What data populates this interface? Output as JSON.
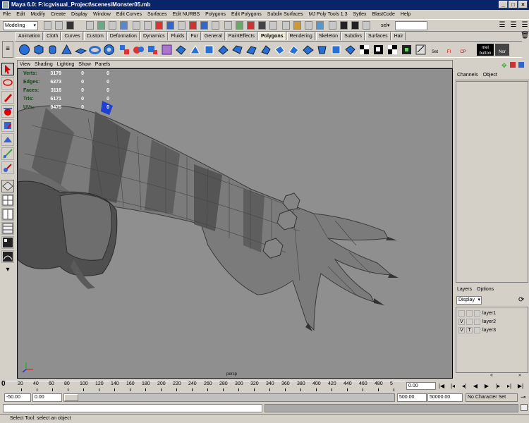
{
  "window": {
    "title": "Maya 6.0: F:\\cgvisual_Project\\scenes\\Monster05.mb"
  },
  "menu": [
    "File",
    "Edit",
    "Modify",
    "Create",
    "Display",
    "Window",
    "Edit Curves",
    "Surfaces",
    "Edit NURBS",
    "Polygons",
    "Edit Polygons",
    "Subdiv Surfaces",
    "MJ Poly Tools 1.3",
    "Sytlex",
    "BlastCode",
    "Help"
  ],
  "status_line": {
    "mode": "Modeling",
    "sel_label": "sel▾"
  },
  "shelf_tabs": [
    "Animation",
    "Cloth",
    "Curves",
    "Custom",
    "Deformation",
    "Dynamics",
    "Fluids",
    "Fur",
    "General",
    "PaintEffects",
    "Polygons",
    "Rendering",
    "Skeleton",
    "Subdivs",
    "Surfaces",
    "Hair"
  ],
  "shelf_active": "Polygons",
  "shelf_labels": [
    "Set",
    "FI",
    "CP",
    "mel button",
    "Nor"
  ],
  "panel_menu": [
    "View",
    "Shading",
    "Lighting",
    "Show",
    "Panels"
  ],
  "hud": [
    {
      "label": "Verts:",
      "a": "3179",
      "b": "0",
      "c": "0"
    },
    {
      "label": "Edges:",
      "a": "6273",
      "b": "0",
      "c": "0"
    },
    {
      "label": "Faces:",
      "a": "3116",
      "b": "0",
      "c": "0"
    },
    {
      "label": "Tris:",
      "a": "6171",
      "b": "0",
      "c": "0"
    },
    {
      "label": "UVs:",
      "a": "9475",
      "b": "0",
      "c": "0"
    }
  ],
  "camera": "persp",
  "channel_box": {
    "menu": [
      "Channels",
      "Object"
    ]
  },
  "layer_editor": {
    "menu": [
      "Layers",
      "Options"
    ],
    "display": "Display",
    "layers": [
      {
        "name": "layer1",
        "v": "",
        "t": ""
      },
      {
        "name": "layer2",
        "v": "V",
        "t": ""
      },
      {
        "name": "layer3",
        "v": "V",
        "t": "T"
      }
    ]
  },
  "timeline": {
    "ticks": [
      "20",
      "40",
      "60",
      "80",
      "100",
      "120",
      "140",
      "160",
      "180",
      "200",
      "220",
      "240",
      "260",
      "280",
      "300",
      "320",
      "340",
      "360",
      "380",
      "400",
      "420",
      "440",
      "460",
      "480",
      "5"
    ],
    "start_tick": "0",
    "current_frame": "0.00"
  },
  "range": {
    "start": "-50.00",
    "playback_start": "0.00",
    "playback_end": "500.00",
    "end": "50000.00",
    "character": "No Character Set"
  },
  "help_line": "Select Tool: select an object",
  "colors": {
    "viewport": "#8f8f8f",
    "title_bar": "#0a246a",
    "ui": "#d4d0c8"
  }
}
